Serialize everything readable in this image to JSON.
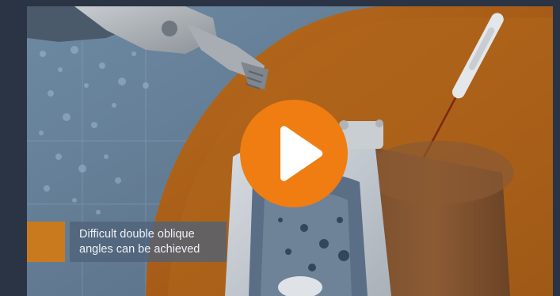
{
  "video": {
    "caption_lines": [
      "Difficult double oblique",
      "angles can be achieved"
    ],
    "play_icon": "play-icon"
  },
  "colors": {
    "background": "#2b3445",
    "accent_orange": "#ef7d12",
    "caption_swatch": "#c97a1e",
    "caption_text": "#eef2f6"
  }
}
